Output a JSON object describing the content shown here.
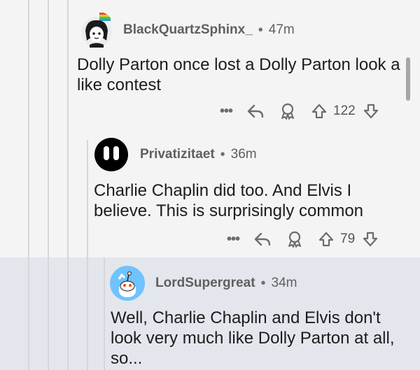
{
  "comments": [
    {
      "username": "BlackQuartzSphinx_",
      "timestamp": "47m",
      "body": "Dolly Parton once lost a Dolly Parton look a like contest",
      "votes": "122",
      "more": "•••"
    },
    {
      "username": "Privatizitaet",
      "timestamp": "36m",
      "body": "Charlie Chaplin did too. And Elvis I believe. This is surprisingly common",
      "votes": "79",
      "more": "•••"
    },
    {
      "username": "LordSupergreat",
      "timestamp": "34m",
      "body": "Well, Charlie Chaplin and Elvis don't look very much like Dolly Parton at all, so..."
    }
  ],
  "separator": "•",
  "icons": {
    "more": "more-options-icon",
    "reply": "reply-icon",
    "award": "award-icon",
    "upvote": "upvote-arrow-icon",
    "downvote": "downvote-arrow-icon"
  },
  "colors": {
    "highlight": "#e3e6ed",
    "avatar_blue": "#6fc3ff",
    "meta_text": "#5f5f5f"
  }
}
